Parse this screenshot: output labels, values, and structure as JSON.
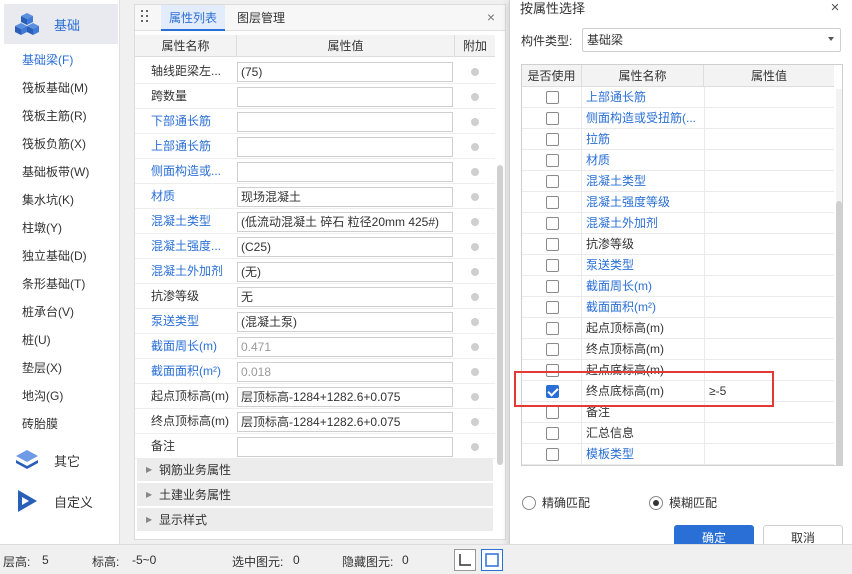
{
  "nav": {
    "categories": [
      {
        "label": "基础",
        "icon": "cubes-icon"
      },
      {
        "label": "其它",
        "icon": "layers-icon"
      },
      {
        "label": "自定义",
        "icon": "play-icon"
      }
    ],
    "items": [
      "基础梁(F)",
      "筏板基础(M)",
      "筏板主筋(R)",
      "筏板负筋(X)",
      "基础板带(W)",
      "集水坑(K)",
      "柱墩(Y)",
      "独立基础(D)",
      "条形基础(T)",
      "桩承台(V)",
      "桩(U)",
      "垫层(X)",
      "地沟(G)",
      "砖胎膜"
    ]
  },
  "panel": {
    "tabs": [
      "属性列表",
      "图层管理"
    ],
    "close": "×",
    "headers": [
      "属性名称",
      "属性值",
      "附加"
    ],
    "rows": [
      {
        "name": "轴线距梁左...",
        "value": "(75)",
        "link": false,
        "grey": false
      },
      {
        "name": "跨数量",
        "value": "",
        "link": false,
        "grey": false
      },
      {
        "name": "下部通长筋",
        "value": "",
        "link": true,
        "grey": false
      },
      {
        "name": "上部通长筋",
        "value": "",
        "link": true,
        "grey": false
      },
      {
        "name": "侧面构造或...",
        "value": "",
        "link": true,
        "grey": false
      },
      {
        "name": "材质",
        "value": "现场混凝土",
        "link": true,
        "grey": false
      },
      {
        "name": "混凝土类型",
        "value": "(低流动混凝土 碎石 粒径20mm 425#)",
        "link": true,
        "grey": false
      },
      {
        "name": "混凝土强度...",
        "value": "(C25)",
        "link": true,
        "grey": false
      },
      {
        "name": "混凝土外加剂",
        "value": "(无)",
        "link": true,
        "grey": false
      },
      {
        "name": "抗渗等级",
        "value": "无",
        "link": false,
        "grey": false
      },
      {
        "name": "泵送类型",
        "value": "(混凝土泵)",
        "link": true,
        "grey": false
      },
      {
        "name": "截面周长(m)",
        "value": "0.471",
        "link": true,
        "grey": true
      },
      {
        "name": "截面面积(m²)",
        "value": "0.018",
        "link": true,
        "grey": true
      },
      {
        "name": "起点顶标高(m)",
        "value": "层顶标高-1284+1282.6+0.075",
        "link": false,
        "grey": false
      },
      {
        "name": "终点顶标高(m)",
        "value": "层顶标高-1284+1282.6+0.075",
        "link": false,
        "grey": false
      },
      {
        "name": "备注",
        "value": "",
        "link": false,
        "grey": false
      }
    ],
    "groups": [
      "钢筋业务属性",
      "土建业务属性",
      "显示样式"
    ]
  },
  "dialog": {
    "title": "按属性选择",
    "close": "×",
    "type_label": "构件类型:",
    "type_value": "基础梁",
    "headers": [
      "是否使用",
      "属性名称",
      "属性值"
    ],
    "rows": [
      {
        "name": "上部通长筋",
        "checked": false,
        "link": true,
        "value": ""
      },
      {
        "name": "侧面构造或受扭筋(...",
        "checked": false,
        "link": true,
        "value": ""
      },
      {
        "name": "拉筋",
        "checked": false,
        "link": true,
        "value": ""
      },
      {
        "name": "材质",
        "checked": false,
        "link": true,
        "value": ""
      },
      {
        "name": "混凝土类型",
        "checked": false,
        "link": true,
        "value": ""
      },
      {
        "name": "混凝土强度等级",
        "checked": false,
        "link": true,
        "value": ""
      },
      {
        "name": "混凝土外加剂",
        "checked": false,
        "link": true,
        "value": ""
      },
      {
        "name": "抗渗等级",
        "checked": false,
        "link": false,
        "value": ""
      },
      {
        "name": "泵送类型",
        "checked": false,
        "link": true,
        "value": ""
      },
      {
        "name": "截面周长(m)",
        "checked": false,
        "link": true,
        "value": ""
      },
      {
        "name": "截面面积(m²)",
        "checked": false,
        "link": true,
        "value": ""
      },
      {
        "name": "起点顶标高(m)",
        "checked": false,
        "link": false,
        "value": ""
      },
      {
        "name": "终点顶标高(m)",
        "checked": false,
        "link": false,
        "value": ""
      },
      {
        "name": "起点底标高(m)",
        "checked": false,
        "link": false,
        "value": ""
      },
      {
        "name": "终点底标高(m)",
        "checked": true,
        "link": false,
        "value": "≥-5"
      },
      {
        "name": "备注",
        "checked": false,
        "link": false,
        "value": ""
      },
      {
        "name": "汇总信息",
        "checked": false,
        "link": false,
        "value": ""
      },
      {
        "name": "模板类型",
        "checked": false,
        "link": true,
        "value": ""
      }
    ],
    "match_options": [
      {
        "label": "精确匹配",
        "selected": false
      },
      {
        "label": "模糊匹配",
        "selected": true
      }
    ],
    "ok_label": "确定",
    "cancel_label": "取消"
  },
  "status": {
    "floor_label": "层高:",
    "floor_value": "5",
    "elev_label": "标高:",
    "elev_value": "-5~0",
    "selected_label": "选中图元:",
    "selected_value": "0",
    "hidden_label": "隐藏图元:",
    "hidden_value": "0"
  },
  "colors": {
    "accent": "#2a6fd6",
    "highlight": "#e53935"
  }
}
